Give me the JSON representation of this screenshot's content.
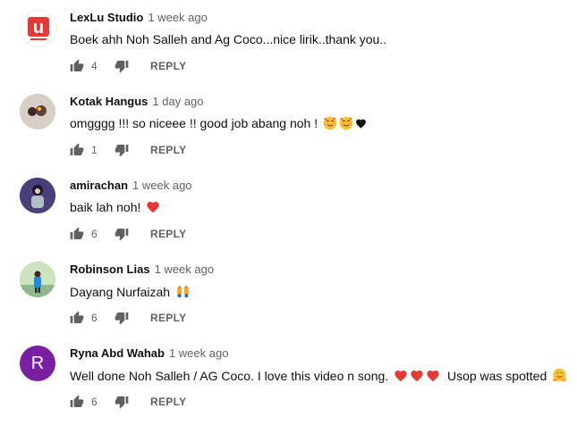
{
  "comments": [
    {
      "author": "LexLu Studio",
      "time": "1 week ago",
      "text": "Boek ahh Noh Salleh and Ag Coco...nice lirik..thank you..",
      "likes": "4",
      "reply": "REPLY",
      "avatar_icon": "lexlu-logo-avatar",
      "avatar_letters": "u",
      "avatar_color": "#e53935"
    },
    {
      "author": "Kotak Hangus",
      "time": "1 day ago",
      "text": "omgggg !!! so niceee !! good job abang noh !",
      "emojis": [
        "smiling-face-with-hearts",
        "smiling-face-with-hearts",
        "black-heart"
      ],
      "likes": "1",
      "reply": "REPLY",
      "avatar_icon": "photo-avatar"
    },
    {
      "author": "amirachan",
      "time": "1 week ago",
      "text": "baik lah noh!",
      "emojis": [
        "red-heart"
      ],
      "likes": "6",
      "reply": "REPLY",
      "avatar_icon": "photo-avatar"
    },
    {
      "author": "Robinson Lias",
      "time": "1 week ago",
      "text": "Dayang Nurfaizah",
      "emojis": [
        "raising-hands"
      ],
      "likes": "6",
      "reply": "REPLY",
      "avatar_icon": "photo-avatar"
    },
    {
      "author": "Ryna Abd Wahab",
      "time": "1 week ago",
      "text": "Well done Noh Salleh / AG Coco. I love this video n song.",
      "text_after": "Usop was spotted",
      "emojis": [
        "red-heart",
        "red-heart",
        "red-heart",
        "hugging-face"
      ],
      "likes": "6",
      "reply": "REPLY",
      "avatar_icon": "letter-avatar",
      "avatar_letter": "R",
      "avatar_color": "#7b1fa2"
    }
  ],
  "colors": {
    "author": "#0f0f0f",
    "meta": "#606060",
    "heart": "#e53935"
  }
}
